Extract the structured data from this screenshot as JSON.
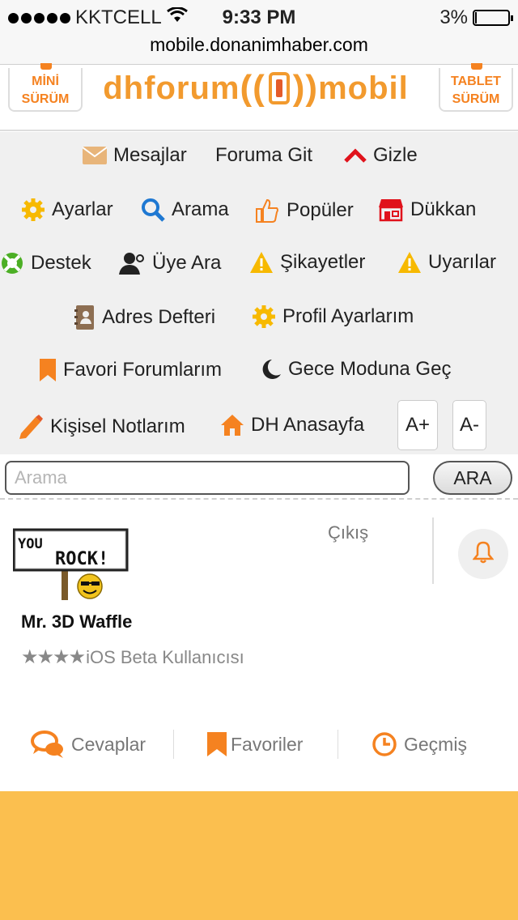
{
  "status": {
    "carrier": "KKTCELL",
    "time": "9:33 PM",
    "battery": "3%"
  },
  "browser": {
    "url": "mobile.donanimhaber.com"
  },
  "header": {
    "mini_line1": "MİNİ",
    "mini_line2": "SÜRÜM",
    "logo_left": "dhforum",
    "logo_right": "mobil",
    "tablet_line1": "TABLET",
    "tablet_line2": "SÜRÜM"
  },
  "menu": {
    "mesajlar": "Mesajlar",
    "foruma_git": "Foruma Git",
    "gizle": "Gizle",
    "ayarlar": "Ayarlar",
    "arama": "Arama",
    "populer": "Popüler",
    "dukkan": "Dükkan",
    "destek": "Destek",
    "uye_ara": "Üye Ara",
    "sikayetler": "Şikayetler",
    "uyarilar": "Uyarılar",
    "adres_defteri": "Adres Defteri",
    "profil_ayarlarim": "Profil Ayarlarım",
    "favori_forumlarim": "Favori Forumlarım",
    "gece_modu": "Gece Moduna Geç",
    "kisisel_notlarim": "Kişisel Notlarım",
    "dh_anasayfa": "DH Anasayfa",
    "font_plus": "A+",
    "font_minus": "A-"
  },
  "search": {
    "placeholder": "Arama",
    "button": "ARA"
  },
  "profile": {
    "avatar_sign_line1": "YOU",
    "avatar_sign_line2": "ROCK!",
    "logout": "Çıkış",
    "username": "Mr. 3D Waffle",
    "stars": "★★★★",
    "rank": "iOS Beta Kullanıcısı"
  },
  "tabs": {
    "cevaplar": "Cevaplar",
    "favoriler": "Favoriler",
    "gecmis": "Geçmiş"
  },
  "colors": {
    "accent": "#f58220",
    "bottom_bg": "#fbbf4f",
    "menu_bg": "#f0f0f0"
  }
}
